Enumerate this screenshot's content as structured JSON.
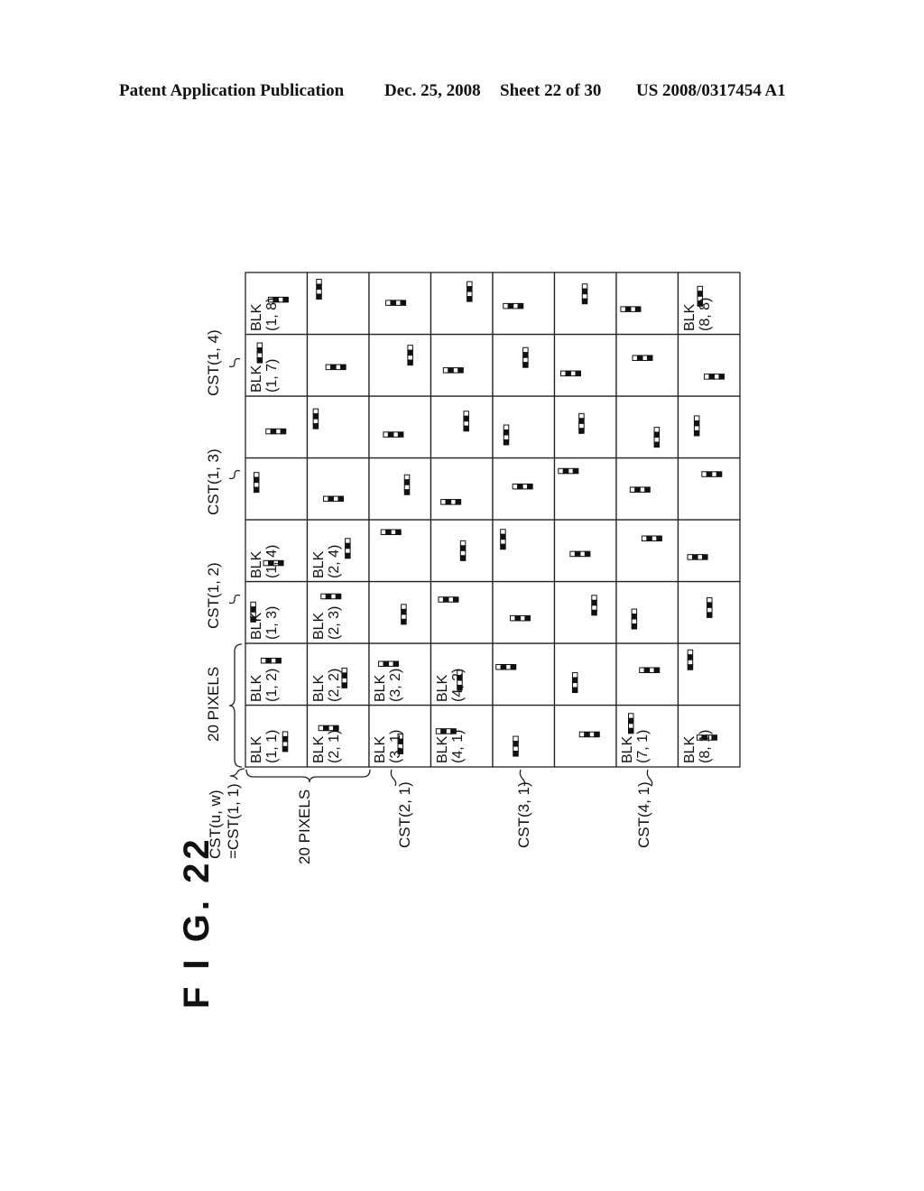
{
  "header": {
    "left": "Patent Application Publication",
    "date": "Dec. 25, 2008",
    "sheet": "Sheet 22 of 30",
    "number": "US 2008/0317454 A1"
  },
  "figure": {
    "label": "F I G. 22",
    "grid_size": 8,
    "block_prefix": "BLK",
    "labeled_blocks": [
      {
        "i": 1,
        "j": 1,
        "text": "BLK (1, 1)"
      },
      {
        "i": 1,
        "j": 2,
        "text": "BLK (1, 2)"
      },
      {
        "i": 1,
        "j": 3,
        "text": "BLK (1, 3)"
      },
      {
        "i": 1,
        "j": 4,
        "text": "BLK (1, 4)"
      },
      {
        "i": 1,
        "j": 7,
        "text": "BLK (1, 7)"
      },
      {
        "i": 1,
        "j": 8,
        "text": "BLK (1, 8)"
      },
      {
        "i": 2,
        "j": 1,
        "text": "BLK (2, 1)"
      },
      {
        "i": 2,
        "j": 2,
        "text": "BLK (2, 2)"
      },
      {
        "i": 2,
        "j": 3,
        "text": "BLK (2, 3)"
      },
      {
        "i": 2,
        "j": 4,
        "text": "BLK (2, 4)"
      },
      {
        "i": 3,
        "j": 1,
        "text": "BLK (3, 1)"
      },
      {
        "i": 3,
        "j": 2,
        "text": "BLK (3, 2)"
      },
      {
        "i": 4,
        "j": 1,
        "text": "BLK (4, 1)"
      },
      {
        "i": 4,
        "j": 2,
        "text": "BLK (4, 2)"
      },
      {
        "i": 7,
        "j": 1,
        "text": "BLK (7, 1)"
      },
      {
        "i": 8,
        "j": 1,
        "text": "BLK (8, 1)"
      },
      {
        "i": 8,
        "j": 8,
        "text": "BLK (8, 8)"
      }
    ],
    "cluster_labels_top": [
      {
        "text": "20 PIXELS"
      },
      {
        "text": "CST(1, 2)"
      },
      {
        "text": "CST(1, 3)"
      },
      {
        "text": "CST(1, 4)"
      }
    ],
    "cluster_labels_left": [
      {
        "text": "CST(u, w)"
      },
      {
        "text": "=CST(1, 1)"
      },
      {
        "text": "20 PIXELS"
      },
      {
        "text": "CST(2, 1)"
      },
      {
        "text": "CST(3, 1)"
      },
      {
        "text": "CST(4, 1)"
      }
    ],
    "markers": [
      {
        "i": 1,
        "j": 1,
        "orient": "v"
      },
      {
        "i": 1,
        "j": 2,
        "orient": "h"
      },
      {
        "i": 1,
        "j": 3,
        "orient": "v"
      },
      {
        "i": 1,
        "j": 4,
        "orient": "h"
      },
      {
        "i": 1,
        "j": 5,
        "orient": "v"
      },
      {
        "i": 1,
        "j": 6,
        "orient": "h"
      },
      {
        "i": 1,
        "j": 7,
        "orient": "v"
      },
      {
        "i": 1,
        "j": 8,
        "orient": "h"
      },
      {
        "i": 2,
        "j": 1,
        "orient": "h"
      },
      {
        "i": 2,
        "j": 2,
        "orient": "v"
      },
      {
        "i": 2,
        "j": 3,
        "orient": "h"
      },
      {
        "i": 2,
        "j": 4,
        "orient": "v"
      },
      {
        "i": 2,
        "j": 5,
        "orient": "h"
      },
      {
        "i": 2,
        "j": 6,
        "orient": "v"
      },
      {
        "i": 2,
        "j": 7,
        "orient": "h"
      },
      {
        "i": 2,
        "j": 8,
        "orient": "v"
      },
      {
        "i": 3,
        "j": 1,
        "orient": "v"
      },
      {
        "i": 3,
        "j": 2,
        "orient": "h"
      },
      {
        "i": 3,
        "j": 3,
        "orient": "v"
      },
      {
        "i": 3,
        "j": 4,
        "orient": "h"
      },
      {
        "i": 3,
        "j": 5,
        "orient": "v"
      },
      {
        "i": 3,
        "j": 6,
        "orient": "h"
      },
      {
        "i": 3,
        "j": 7,
        "orient": "v"
      },
      {
        "i": 3,
        "j": 8,
        "orient": "h"
      },
      {
        "i": 4,
        "j": 1,
        "orient": "h"
      },
      {
        "i": 4,
        "j": 2,
        "orient": "v"
      },
      {
        "i": 4,
        "j": 3,
        "orient": "h"
      },
      {
        "i": 4,
        "j": 4,
        "orient": "v"
      },
      {
        "i": 4,
        "j": 5,
        "orient": "h"
      },
      {
        "i": 4,
        "j": 6,
        "orient": "v"
      },
      {
        "i": 4,
        "j": 7,
        "orient": "h"
      },
      {
        "i": 4,
        "j": 8,
        "orient": "v"
      },
      {
        "i": 5,
        "j": 1,
        "orient": "v"
      },
      {
        "i": 5,
        "j": 2,
        "orient": "h"
      },
      {
        "i": 5,
        "j": 3,
        "orient": "h"
      },
      {
        "i": 5,
        "j": 4,
        "orient": "v"
      },
      {
        "i": 5,
        "j": 5,
        "orient": "h"
      },
      {
        "i": 5,
        "j": 6,
        "orient": "v"
      },
      {
        "i": 5,
        "j": 7,
        "orient": "v"
      },
      {
        "i": 5,
        "j": 8,
        "orient": "h"
      },
      {
        "i": 6,
        "j": 1,
        "orient": "h"
      },
      {
        "i": 6,
        "j": 2,
        "orient": "v"
      },
      {
        "i": 6,
        "j": 3,
        "orient": "v"
      },
      {
        "i": 6,
        "j": 4,
        "orient": "h"
      },
      {
        "i": 6,
        "j": 5,
        "orient": "h"
      },
      {
        "i": 6,
        "j": 6,
        "orient": "v"
      },
      {
        "i": 6,
        "j": 7,
        "orient": "h"
      },
      {
        "i": 6,
        "j": 8,
        "orient": "v"
      },
      {
        "i": 7,
        "j": 1,
        "orient": "v"
      },
      {
        "i": 7,
        "j": 2,
        "orient": "h"
      },
      {
        "i": 7,
        "j": 3,
        "orient": "v"
      },
      {
        "i": 7,
        "j": 4,
        "orient": "h"
      },
      {
        "i": 7,
        "j": 5,
        "orient": "h"
      },
      {
        "i": 7,
        "j": 6,
        "orient": "v"
      },
      {
        "i": 7,
        "j": 7,
        "orient": "h"
      },
      {
        "i": 7,
        "j": 8,
        "orient": "h"
      },
      {
        "i": 8,
        "j": 1,
        "orient": "h"
      },
      {
        "i": 8,
        "j": 2,
        "orient": "v"
      },
      {
        "i": 8,
        "j": 3,
        "orient": "v"
      },
      {
        "i": 8,
        "j": 4,
        "orient": "h"
      },
      {
        "i": 8,
        "j": 5,
        "orient": "h"
      },
      {
        "i": 8,
        "j": 6,
        "orient": "v"
      },
      {
        "i": 8,
        "j": 7,
        "orient": "h"
      },
      {
        "i": 8,
        "j": 8,
        "orient": "v"
      }
    ]
  }
}
